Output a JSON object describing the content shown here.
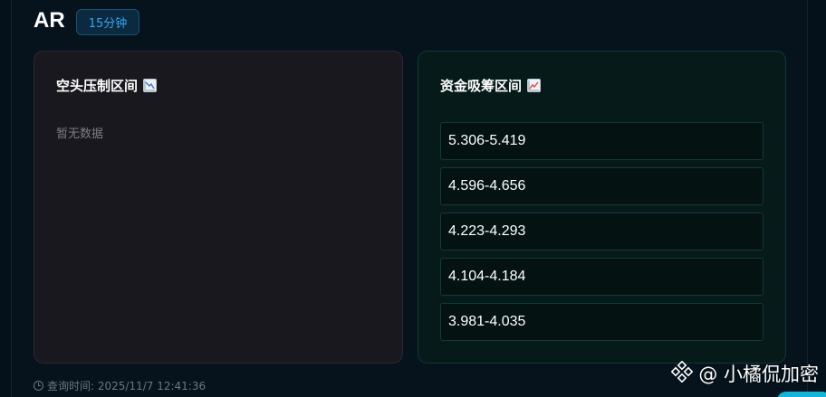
{
  "header": {
    "symbol": "AR",
    "timeframe": "15分钟"
  },
  "short_panel": {
    "title": "空头压制区间",
    "icon": "chart-decreasing-icon",
    "empty_text": "暂无数据"
  },
  "long_panel": {
    "title": "资金吸筹区间",
    "icon": "chart-increasing-icon",
    "ranges": [
      "5.306-5.419",
      "4.596-4.656",
      "4.223-4.293",
      "4.104-4.184",
      "3.981-4.035"
    ]
  },
  "footer": {
    "query_time": "查询时间: 2025/11/7 12:41:36"
  },
  "watermark": {
    "text": "@ 小橘侃加密"
  },
  "colors": {
    "accent": "#3aa3ec",
    "short_bg": "#19181f",
    "long_bg": "#061a19"
  }
}
